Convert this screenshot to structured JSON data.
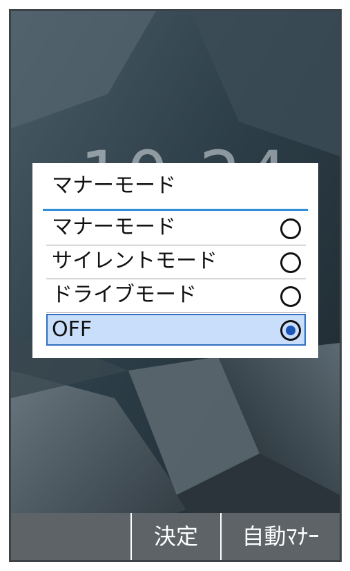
{
  "lock_screen": {
    "clock": "10:24"
  },
  "dialog": {
    "title": "マナーモード",
    "options": [
      {
        "label": "マナーモード",
        "selected": false
      },
      {
        "label": "サイレントモード",
        "selected": false
      },
      {
        "label": "ドライブモード",
        "selected": false
      },
      {
        "label": "OFF",
        "selected": true
      }
    ],
    "accent_color": "#2f8ed8",
    "selected_bg": "#c9defa"
  },
  "softkeys": {
    "left": "",
    "center": "決定",
    "right": "自動ﾏﾅｰ"
  }
}
